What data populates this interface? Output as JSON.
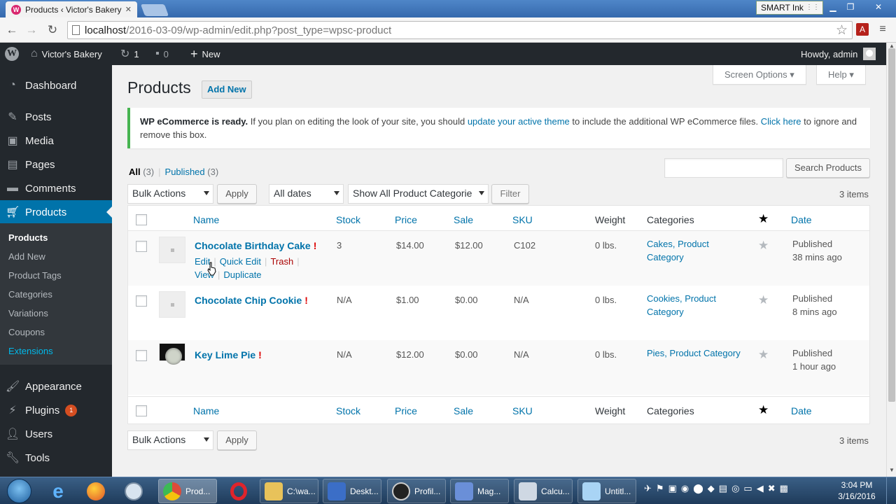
{
  "browser": {
    "tab_title": "Products ‹ Victor's Bakery",
    "tab_favicon": "W",
    "smart_ink": "SMART Ink",
    "address_domain": "localhost",
    "address_path": "/2016-03-09/wp-admin/edit.php?post_type=wpsc-product",
    "icons": [
      "back-icon",
      "forward-icon",
      "reload-icon",
      "page-icon",
      "bookmark-star-icon",
      "pdf-icon",
      "menu-icon"
    ]
  },
  "adminbar": {
    "logo": "W",
    "site_name": "Victor's Bakery",
    "updates_count": "1",
    "comments_count": "0",
    "new_label": "New",
    "howdy": "Howdy, admin"
  },
  "sidebar": {
    "items": [
      {
        "label": "Dashboard",
        "icon": "dashboard-icon"
      },
      {
        "label": "Posts",
        "icon": "pin-icon"
      },
      {
        "label": "Media",
        "icon": "media-icon"
      },
      {
        "label": "Pages",
        "icon": "pages-icon"
      },
      {
        "label": "Comments",
        "icon": "comments-icon"
      },
      {
        "label": "Products",
        "icon": "cart-icon"
      },
      {
        "label": "Appearance",
        "icon": "brush-icon"
      },
      {
        "label": "Plugins",
        "icon": "plug-icon",
        "badge": "1"
      },
      {
        "label": "Users",
        "icon": "user-icon"
      },
      {
        "label": "Tools",
        "icon": "wrench-icon"
      }
    ],
    "submenu": [
      "Products",
      "Add New",
      "Product Tags",
      "Categories",
      "Variations",
      "Coupons",
      "Extensions"
    ]
  },
  "header": {
    "screen_options": "Screen Options",
    "help": "Help",
    "title": "Products",
    "add_new": "Add New"
  },
  "notice": {
    "bold": "WP eCommerce is ready.",
    "text1": " If you plan on editing the look of your site, you should ",
    "link1": "update your active theme",
    "text2": " to include the additional WP eCommerce files. ",
    "link2": "Click here",
    "text3": " to ignore and remove this box."
  },
  "filters": {
    "all": "All",
    "all_count": "(3)",
    "published": "Published",
    "published_count": "(3)",
    "search_button": "Search Products",
    "bulk_actions": "Bulk Actions",
    "apply": "Apply",
    "all_dates": "All dates",
    "category_filter": "Show All Product Categorie",
    "filter": "Filter",
    "items_count": "3 items"
  },
  "table": {
    "columns": [
      "Name",
      "Stock",
      "Price",
      "Sale",
      "SKU",
      "Weight",
      "Categories",
      "★",
      "Date"
    ],
    "rows": [
      {
        "name": "Chocolate Birthday Cake",
        "flag": "!",
        "stock": "3",
        "price": "$14.00",
        "sale": "$12.00",
        "sku": "C102",
        "weight": "0 lbs.",
        "categories": [
          "Cakes",
          "Product Category"
        ],
        "status": "Published",
        "ago": "38 mins ago",
        "actions": [
          "Edit",
          "Quick Edit",
          "Trash",
          "View",
          "Duplicate"
        ]
      },
      {
        "name": "Chocolate Chip Cookie",
        "flag": "!",
        "stock": "N/A",
        "price": "$1.00",
        "sale": "$0.00",
        "sku": "N/A",
        "weight": "0 lbs.",
        "categories": [
          "Cookies",
          "Product Category"
        ],
        "status": "Published",
        "ago": "8 mins ago"
      },
      {
        "name": "Key Lime Pie",
        "flag": "!",
        "stock": "N/A",
        "price": "$12.00",
        "sale": "$0.00",
        "sku": "N/A",
        "weight": "0 lbs.",
        "categories": [
          "Pies",
          "Product Category"
        ],
        "status": "Published",
        "ago": "1 hour ago"
      }
    ]
  },
  "bottom": {
    "bulk_actions": "Bulk Actions",
    "apply": "Apply",
    "items_count": "3 items"
  },
  "taskbar": {
    "buttons": [
      {
        "label": "Prod...",
        "icon": "chrome-icon",
        "color": "#dd4b39"
      },
      {
        "label": "C:\\wa...",
        "icon": "folder-icon",
        "color": "#e8c25a"
      },
      {
        "label": "Deskt...",
        "icon": "desktop-icon",
        "color": "#3b6ec7"
      },
      {
        "label": "Profil...",
        "icon": "obs-icon",
        "color": "#222222"
      },
      {
        "label": "Mag...",
        "icon": "magnifier-icon",
        "color": "#6a8fd8"
      },
      {
        "label": "Calcu...",
        "icon": "calculator-icon",
        "color": "#cfd8e3"
      },
      {
        "label": "Untitl...",
        "icon": "notepad-icon",
        "color": "#a9d4f5"
      }
    ],
    "time": "3:04 PM",
    "date": "3/16/2016"
  }
}
